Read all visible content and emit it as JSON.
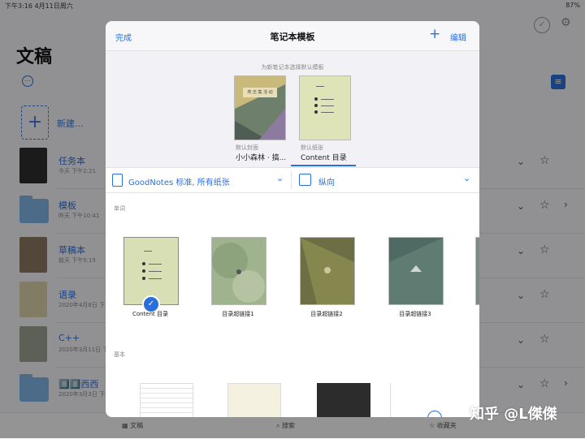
{
  "status": {
    "left": "下午3:16  4月11日周六",
    "right": "87%"
  },
  "background": {
    "title": "文稿",
    "new_label": "新建...",
    "rows": [
      {
        "name": "任务本",
        "sub": "今天 下午2:21",
        "thumb": "#2e2e2e"
      },
      {
        "name": "模板",
        "sub": "昨天 下午10:41",
        "thumb": "folder"
      },
      {
        "name": "草稿本",
        "sub": "前天 下午5:15",
        "thumb": "#8a7760"
      },
      {
        "name": "语录",
        "sub": "2020年4月8日 下午...",
        "thumb": "#d9cfa8"
      },
      {
        "name": "C++",
        "sub": "2020年3月11日 下午...",
        "thumb": "#9aa08f"
      },
      {
        "name": "8️⃣8️⃣西西",
        "sub": "2020年3月3日 下午...",
        "thumb": "folder"
      }
    ],
    "tabs": {
      "docs": "文稿",
      "search": "搜索",
      "favorites": "收藏夹"
    }
  },
  "modal": {
    "done": "完成",
    "title": "笔记本模板",
    "edit": "编辑",
    "hint": "为新笔记本选择默认模板",
    "cover_sub": "默认封面",
    "cover_name": "小小森林 · 搞...",
    "cover_text": "燕 志 集 活 动",
    "paper_sub": "默认纸张",
    "paper_name": "Content 目录",
    "left_select": "GoodNotes 标准, 所有纸张",
    "right_select": "纵向",
    "section1": "单词",
    "section2": "基本",
    "templates": [
      {
        "label": "Content 目录",
        "color": "#d9dfb4",
        "selected": true
      },
      {
        "label": "目录超链接1",
        "color": "#9fb38e"
      },
      {
        "label": "目录超链接2",
        "color": "#6e6e45"
      },
      {
        "label": "目录超链接3",
        "color": "#4e6a62"
      }
    ]
  },
  "watermark": "知乎 @L傑傑"
}
